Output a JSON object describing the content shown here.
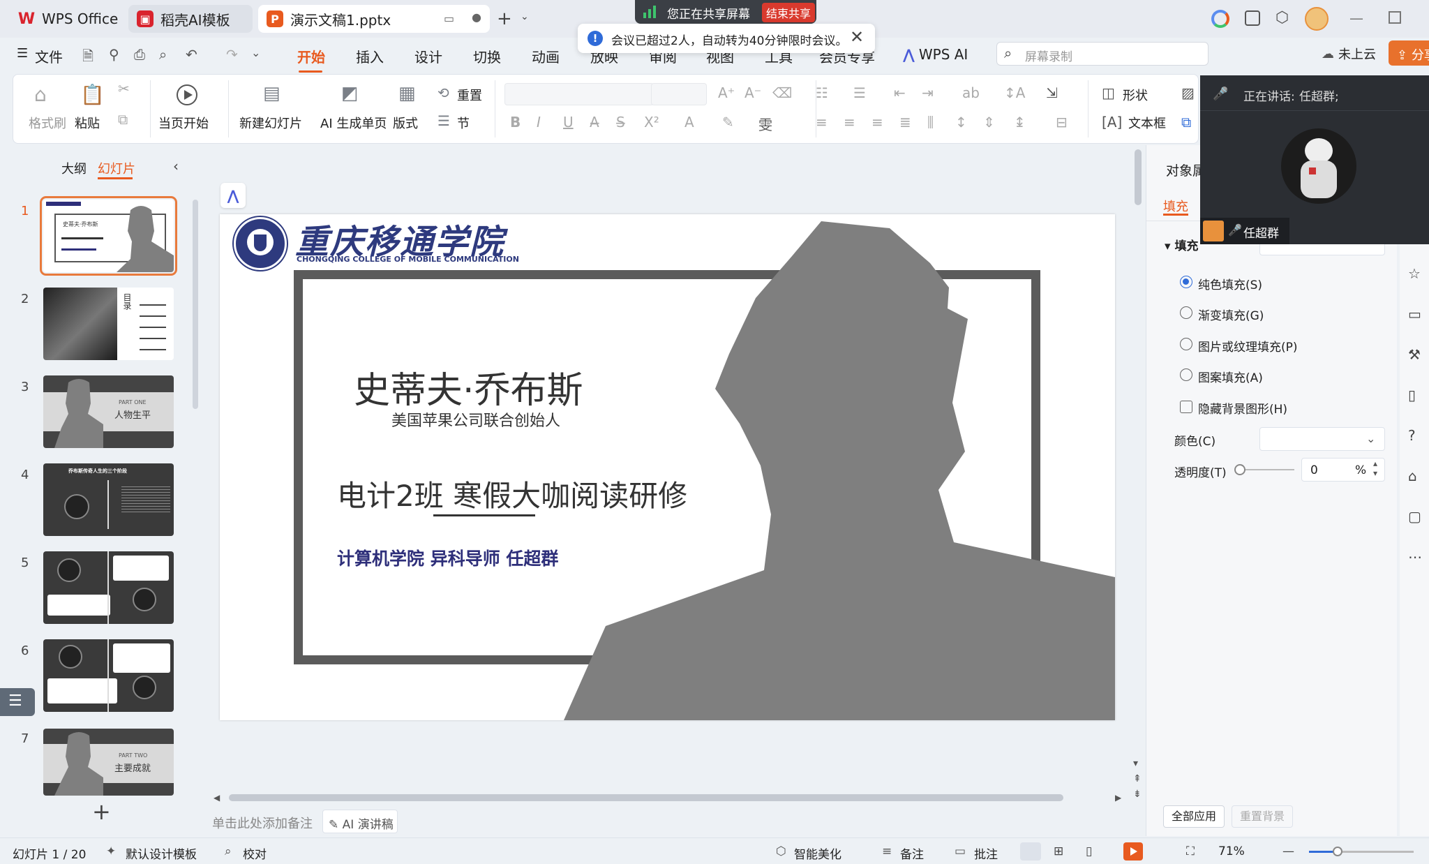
{
  "tabs": [
    {
      "label": "WPS Office"
    },
    {
      "label": "稻壳AI模板"
    },
    {
      "label": "演示文稿1.pptx"
    }
  ],
  "share_banner": {
    "text": "您正在共享屏幕",
    "end_button": "结束共享"
  },
  "meeting_notice": {
    "text": "会议已超过2人，自动转为40分钟限时会议。"
  },
  "menu": {
    "file": "文件",
    "items": [
      "开始",
      "插入",
      "设计",
      "切换",
      "动画",
      "放映",
      "审阅",
      "视图",
      "工具",
      "会员专享"
    ],
    "wps_ai": "WPS AI",
    "search_placeholder": "屏幕录制",
    "cloud": "未上云",
    "share": "分享"
  },
  "ribbon": {
    "format_painter": "格式刷",
    "paste": "粘贴",
    "play_from_current": "当页开始",
    "new_slide": "新建幻灯片",
    "ai_single": "AI 生成单页",
    "layout": "版式",
    "reset": "重置",
    "section": "节",
    "shape": "形状",
    "textbox": "文本框"
  },
  "left_panel": {
    "tab_outline": "大纲",
    "tab_slides": "幻灯片",
    "slides": [
      {
        "num": "1",
        "caption": "史蒂夫·乔布斯"
      },
      {
        "num": "2",
        "caption": "目录"
      },
      {
        "num": "3",
        "part": "PART ONE",
        "caption": "人物生平"
      },
      {
        "num": "4",
        "caption": "乔布斯传奇人生的三个阶段"
      },
      {
        "num": "5",
        "caption": ""
      },
      {
        "num": "6",
        "caption": ""
      },
      {
        "num": "7",
        "part": "PART TWO",
        "caption": "主要成就"
      }
    ]
  },
  "slide": {
    "college_cn": "重庆移通学院",
    "college_en": "CHONGQING COLLEGE OF MOBILE COMMUNICATION",
    "title": "史蒂夫·乔布斯",
    "subtitle": "美国苹果公司联合创始人",
    "heading": "电计2班 寒假大咖阅读研修",
    "author": "计算机学院 异科导师 任超群"
  },
  "notes": {
    "placeholder": "单击此处添加备注",
    "ai_button": "AI 演讲稿"
  },
  "right_panel": {
    "title": "对象属性",
    "tab_fill": "填充",
    "section_fill": "填充",
    "options": [
      "纯色填充(S)",
      "渐变填充(G)",
      "图片或纹理填充(P)",
      "图案填充(A)"
    ],
    "selected_option": 0,
    "hide_bg": "隐藏背景图形(H)",
    "color_label": "颜色(C)",
    "transparency_label": "透明度(T)",
    "transparency_value": "0",
    "transparency_unit": "%",
    "apply_all": "全部应用",
    "reset_bg": "重置背景"
  },
  "video": {
    "speaking": "正在讲话:",
    "speaker": "任超群;",
    "name_tag": "任超群"
  },
  "status": {
    "slide_counter": "幻灯片 1 / 20",
    "template": "默认设计模板",
    "proof": "校对",
    "beautify": "智能美化",
    "notes": "备注",
    "comments": "批注",
    "zoom": "71%",
    "zoom_fraction": 0.27
  }
}
